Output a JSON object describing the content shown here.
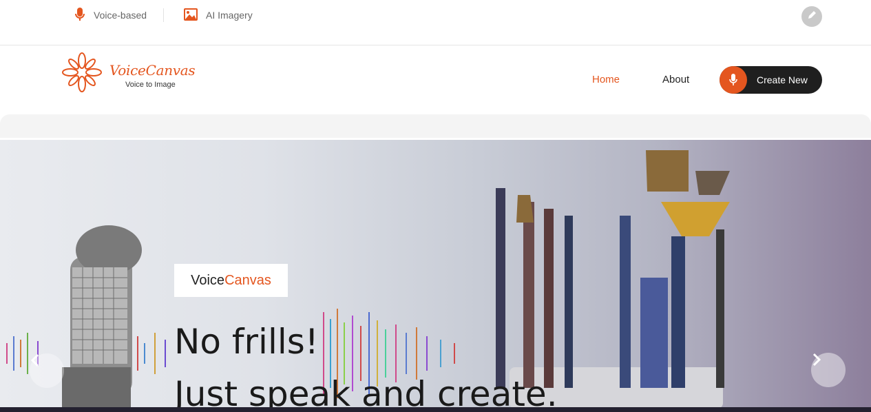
{
  "topbar": {
    "items": [
      {
        "label": "Voice-based",
        "icon": "microphone-icon"
      },
      {
        "label": "AI Imagery",
        "icon": "image-icon"
      }
    ],
    "edit_icon": "pencil-icon"
  },
  "logo": {
    "title": "VoiceCanvas",
    "subtitle": "Voice to Image"
  },
  "nav": {
    "home": "Home",
    "about": "About",
    "create": "Create New"
  },
  "hero": {
    "brand_part1": "Voice",
    "brand_part2": "Canvas",
    "headline_line1": "No frills!",
    "headline_line2": "Just speak and create."
  },
  "colors": {
    "accent": "#e4561f",
    "dark": "#1f1f1f"
  }
}
